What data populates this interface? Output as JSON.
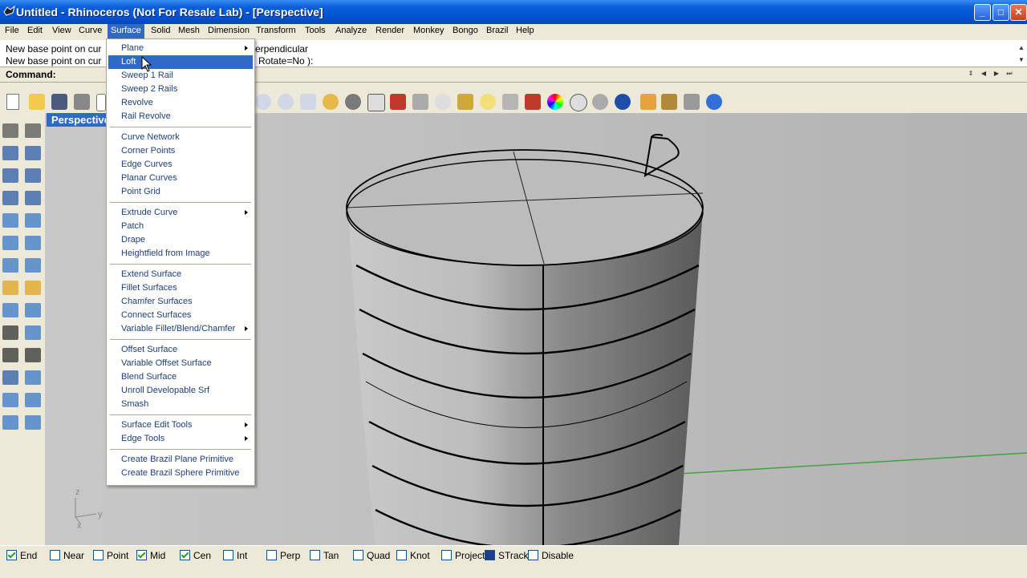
{
  "window": {
    "title": "Untitled - Rhinoceros (Not For Resale Lab) - [Perspective]"
  },
  "menubar": {
    "items": [
      {
        "label": "File"
      },
      {
        "label": "Edit"
      },
      {
        "label": "View"
      },
      {
        "label": "Curve"
      },
      {
        "label": "Surface"
      },
      {
        "label": "Solid"
      },
      {
        "label": "Mesh"
      },
      {
        "label": "Dimension"
      },
      {
        "label": "Transform"
      },
      {
        "label": "Tools"
      },
      {
        "label": "Analyze"
      },
      {
        "label": "Render"
      },
      {
        "label": "Monkey"
      },
      {
        "label": "Bongo"
      },
      {
        "label": "Brazil"
      },
      {
        "label": "Help"
      }
    ],
    "active": "Surface"
  },
  "command": {
    "history": [
      {
        "left": "New base point on cur",
        "right": "erpendicular"
      },
      {
        "left": "New base point on cur",
        "right": "Rotate=No ):"
      }
    ],
    "prompt_label": "Command:"
  },
  "viewport": {
    "title": "Perspective",
    "axis_labels": {
      "z": "z",
      "y": "y",
      "x": "x"
    }
  },
  "surface_menu": {
    "groups": [
      [
        {
          "label": "Plane",
          "submenu": true
        },
        {
          "label": "Loft",
          "submenu": false,
          "highlighted": true
        },
        {
          "label": "Sweep 1 Rail",
          "submenu": false
        },
        {
          "label": "Sweep 2 Rails",
          "submenu": false
        },
        {
          "label": "Revolve",
          "submenu": false
        },
        {
          "label": "Rail Revolve",
          "submenu": false
        }
      ],
      [
        {
          "label": "Curve Network",
          "submenu": false
        },
        {
          "label": "Corner Points",
          "submenu": false
        },
        {
          "label": "Edge Curves",
          "submenu": false
        },
        {
          "label": "Planar Curves",
          "submenu": false
        },
        {
          "label": "Point Grid",
          "submenu": false
        }
      ],
      [
        {
          "label": "Extrude Curve",
          "submenu": true
        },
        {
          "label": "Patch",
          "submenu": false
        },
        {
          "label": "Drape",
          "submenu": false
        },
        {
          "label": "Heightfield from Image",
          "submenu": false
        }
      ],
      [
        {
          "label": "Extend Surface",
          "submenu": false
        },
        {
          "label": "Fillet Surfaces",
          "submenu": false
        },
        {
          "label": "Chamfer Surfaces",
          "submenu": false
        },
        {
          "label": "Connect Surfaces",
          "submenu": false
        },
        {
          "label": "Variable Fillet/Blend/Chamfer",
          "submenu": true
        }
      ],
      [
        {
          "label": "Offset Surface",
          "submenu": false
        },
        {
          "label": "Variable Offset Surface",
          "submenu": false
        },
        {
          "label": "Blend Surface",
          "submenu": false
        },
        {
          "label": "Unroll Developable Srf",
          "submenu": false
        },
        {
          "label": "Smash",
          "submenu": false
        }
      ],
      [
        {
          "label": "Surface Edit Tools",
          "submenu": true
        },
        {
          "label": "Edge Tools",
          "submenu": true
        }
      ],
      [
        {
          "label": "Create Brazil Plane Primitive",
          "submenu": false
        },
        {
          "label": "Create Brazil Sphere Primitive",
          "submenu": false
        }
      ]
    ]
  },
  "osnaps": [
    {
      "label": "End",
      "state": "checked"
    },
    {
      "label": "Near",
      "state": "unchecked"
    },
    {
      "label": "Point",
      "state": "unchecked"
    },
    {
      "label": "Mid",
      "state": "checked"
    },
    {
      "label": "Cen",
      "state": "checked"
    },
    {
      "label": "Int",
      "state": "unchecked"
    },
    {
      "label": "Perp",
      "state": "unchecked"
    },
    {
      "label": "Tan",
      "state": "unchecked"
    },
    {
      "label": "Quad",
      "state": "unchecked"
    },
    {
      "label": "Knot",
      "state": "unchecked"
    },
    {
      "label": "Project",
      "state": "unchecked"
    },
    {
      "label": "STrack",
      "state": "filled"
    },
    {
      "label": "Disable",
      "state": "unchecked"
    }
  ],
  "colors": {
    "title_bar": "#0a5fd8",
    "menu_highlight": "#316ac5",
    "viewport_bg": "#b9b9b9",
    "axis_green": "#3fa33f"
  }
}
